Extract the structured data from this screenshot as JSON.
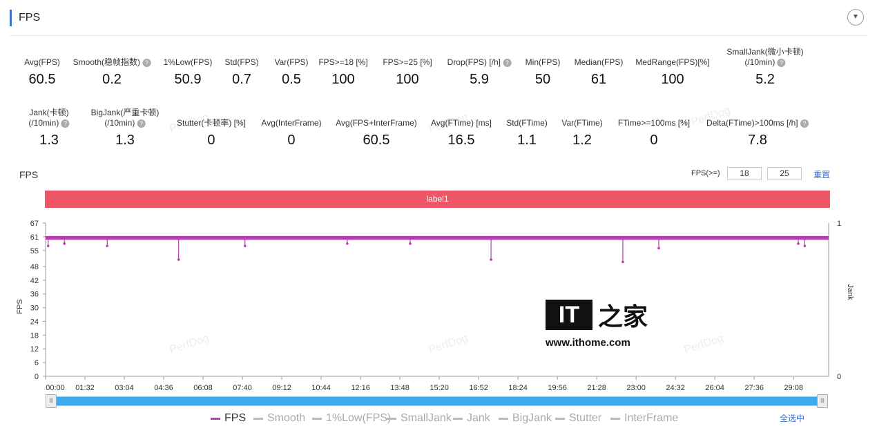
{
  "header": {
    "title": "FPS",
    "collapse_icon": "chevron-down-icon"
  },
  "metrics_row1": [
    {
      "label": "Avg(FPS)",
      "value": "60.5",
      "help": false
    },
    {
      "label": "Smooth(稳帧指数)",
      "value": "0.2",
      "help": true
    },
    {
      "label": "1%Low(FPS)",
      "value": "50.9",
      "help": false
    },
    {
      "label": "Std(FPS)",
      "value": "0.7",
      "help": false
    },
    {
      "label": "Var(FPS)",
      "value": "0.5",
      "help": false
    },
    {
      "label": "FPS>=18 [%]",
      "value": "100",
      "help": false
    },
    {
      "label": "FPS>=25 [%]",
      "value": "100",
      "help": false
    },
    {
      "label": "Drop(FPS) [/h]",
      "value": "5.9",
      "help": true
    },
    {
      "label": "Min(FPS)",
      "value": "50",
      "help": false
    },
    {
      "label": "Median(FPS)",
      "value": "61",
      "help": false
    },
    {
      "label": "MedRange(FPS)[%]",
      "value": "100",
      "help": false
    },
    {
      "label": "SmallJank(微小卡顿)",
      "label2": "(/10min)",
      "value": "5.2",
      "help": true
    }
  ],
  "metrics_row2": [
    {
      "label": "Jank(卡顿)",
      "label2": "(/10min)",
      "value": "1.3",
      "help": true
    },
    {
      "label": "BigJank(严重卡顿)",
      "label2": "(/10min)",
      "value": "1.3",
      "help": true
    },
    {
      "label": "Stutter(卡顿率) [%]",
      "value": "0",
      "help": false
    },
    {
      "label": "Avg(InterFrame)",
      "value": "0",
      "help": false
    },
    {
      "label": "Avg(FPS+InterFrame)",
      "value": "60.5",
      "help": false
    },
    {
      "label": "Avg(FTime) [ms]",
      "value": "16.5",
      "help": false
    },
    {
      "label": "Std(FTime)",
      "value": "1.1",
      "help": false
    },
    {
      "label": "Var(FTime)",
      "value": "1.2",
      "help": false
    },
    {
      "label": "FTime>=100ms [%]",
      "value": "0",
      "help": false
    },
    {
      "label": "Delta(FTime)>100ms [/h]",
      "value": "7.8",
      "help": true
    }
  ],
  "chart_controls": {
    "title": "FPS",
    "threshold_label": "FPS(>=)",
    "threshold1": "18",
    "threshold2": "25",
    "reset": "重置",
    "label_bar": "label1"
  },
  "watermark": "PerfDog",
  "logo": {
    "text": "IT之家",
    "url_text": "www.ithome.com"
  },
  "chart_data": {
    "type": "line",
    "ylabel": "FPS",
    "ylabel_right": "Jank",
    "ylim": [
      0,
      67
    ],
    "y_ticks": [
      "0",
      "6",
      "12",
      "18",
      "24",
      "30",
      "36",
      "42",
      "48",
      "55",
      "61",
      "67"
    ],
    "y_right_ticks": [
      "0",
      "1"
    ],
    "x_ticks": [
      "00:00",
      "01:32",
      "03:04",
      "04:36",
      "06:08",
      "07:40",
      "09:12",
      "10:44",
      "12:16",
      "13:48",
      "15:20",
      "16:52",
      "18:24",
      "19:56",
      "21:28",
      "23:00",
      "24:32",
      "26:04",
      "27:36",
      "29:08"
    ],
    "x_range": [
      "00:00",
      "30:30"
    ],
    "series": [
      {
        "name": "FPS",
        "color": "#b63cb0",
        "baseline": 60.5,
        "dips": [
          [
            "00:06",
            57
          ],
          [
            "00:44",
            58
          ],
          [
            "02:24",
            57
          ],
          [
            "05:11",
            51
          ],
          [
            "07:46",
            57
          ],
          [
            "11:45",
            58
          ],
          [
            "14:12",
            58
          ],
          [
            "17:21",
            51
          ],
          [
            "22:29",
            50
          ],
          [
            "23:53",
            56
          ],
          [
            "29:19",
            58
          ],
          [
            "29:34",
            57
          ]
        ]
      }
    ],
    "legend": [
      {
        "name": "FPS",
        "active": true
      },
      {
        "name": "Smooth",
        "active": false
      },
      {
        "name": "1%Low(FPS)",
        "active": false
      },
      {
        "name": "SmallJank",
        "active": false
      },
      {
        "name": "Jank",
        "active": false
      },
      {
        "name": "BigJank",
        "active": false
      },
      {
        "name": "Stutter",
        "active": false
      },
      {
        "name": "InterFrame",
        "active": false
      }
    ],
    "select_all": "全选中"
  }
}
